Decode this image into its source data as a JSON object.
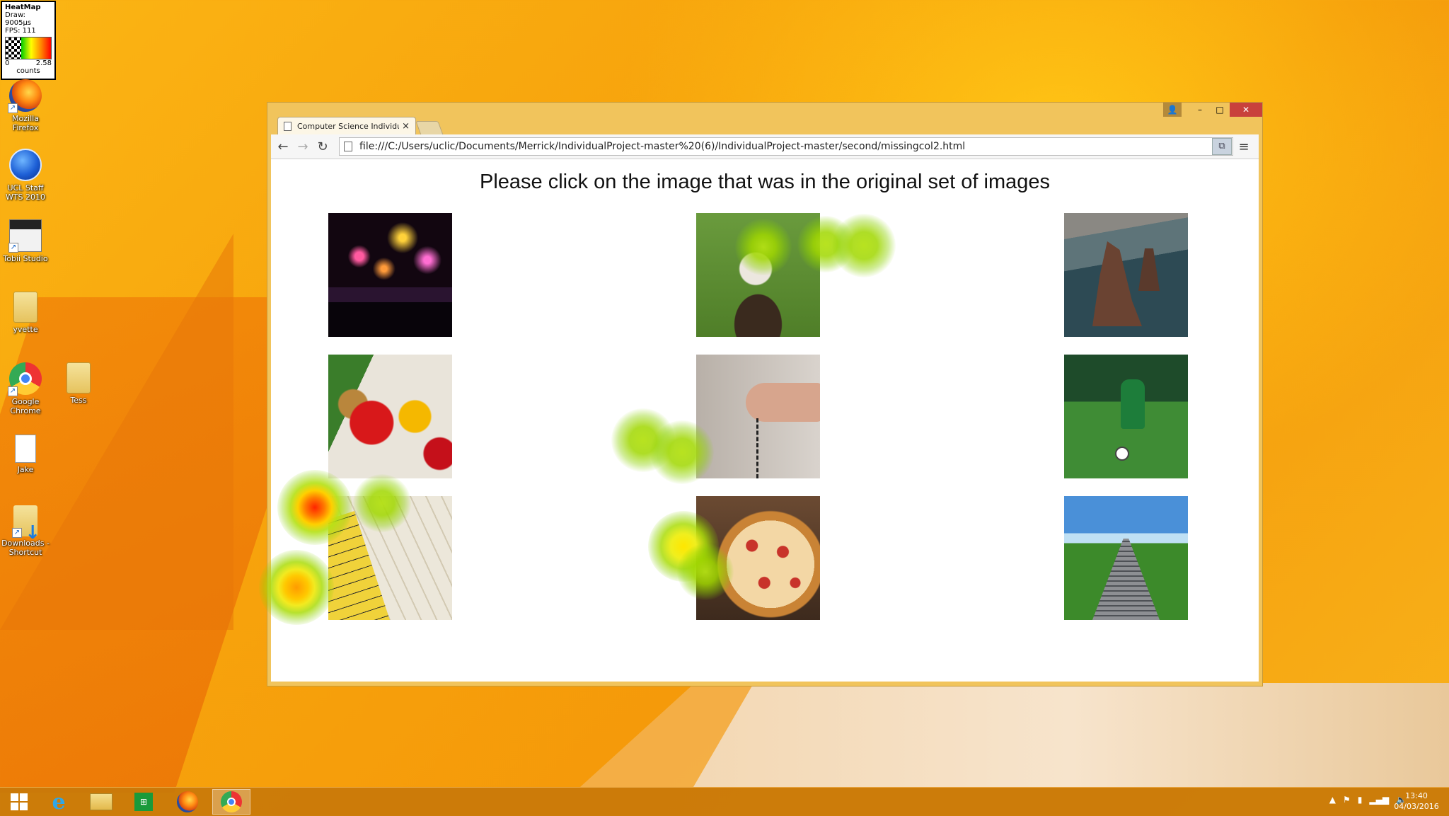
{
  "heatmap_legend": {
    "title": "HeatMap",
    "draw": "Draw: 9005µs",
    "fps": "FPS: 111",
    "min": "0",
    "max": "2.58",
    "unit": "counts"
  },
  "desktop_icons": [
    {
      "label": "Mozilla Firefox",
      "icon": "firefox-icon"
    },
    {
      "label": "UCL Staff WTS 2010",
      "icon": "remote-desktop-icon"
    },
    {
      "label": "Tobii Studio",
      "icon": "tobii-studio-icon"
    },
    {
      "label": "yvette",
      "icon": "folder-icon"
    },
    {
      "label": "Google Chrome",
      "icon": "chrome-icon"
    },
    {
      "label": "Tess",
      "icon": "folder-icon"
    },
    {
      "label": "Jake",
      "icon": "document-icon"
    },
    {
      "label": "Downloads - Shortcut",
      "icon": "downloads-folder-icon"
    }
  ],
  "browser": {
    "tab_title": "Computer Science Individu",
    "url": "file:///C:/Users/uclic/Documents/Merrick/IndividualProject-master%20(6)/IndividualProject-master/second/missingcol2.html",
    "close_glyph": "×",
    "window_controls": {
      "minimize": "–",
      "maximize": "□",
      "close": "✕"
    }
  },
  "page": {
    "heading": "Please click on the image that was in the original set of images",
    "images": [
      {
        "name": "fireworks"
      },
      {
        "name": "eagle"
      },
      {
        "name": "sea-stacks"
      },
      {
        "name": "vegetables"
      },
      {
        "name": "hand-with-cable"
      },
      {
        "name": "boy-playing-soccer"
      },
      {
        "name": "measuring-tape"
      },
      {
        "name": "pizza"
      },
      {
        "name": "park-stairs"
      }
    ]
  },
  "taskbar": {
    "apps": [
      "start-icon",
      "internet-explorer-icon",
      "file-explorer-icon",
      "store-icon",
      "firefox-icon",
      "chrome-icon"
    ],
    "active_app": "chrome-icon",
    "time": "13:40",
    "date": "04/03/2016"
  },
  "colors": {
    "desktop": "#f8a812",
    "window_frame": "#f1c45c",
    "close_button": "#c9413c",
    "taskbar": "#c8780a"
  }
}
